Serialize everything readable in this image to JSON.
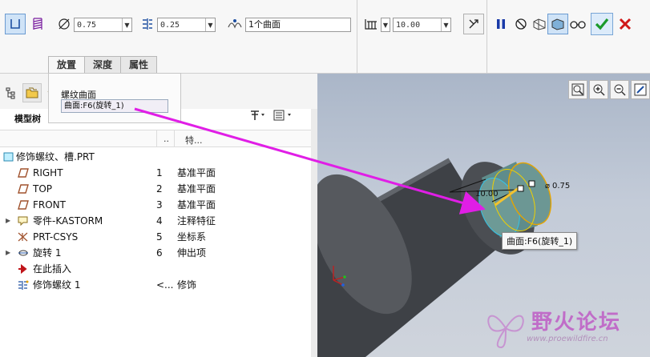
{
  "toolbar": {
    "diameter_value": "0.75",
    "pitch_value": "0.25",
    "surface_ref": "1个曲面",
    "depth_value": "10.00"
  },
  "tabs": [
    {
      "label": "放置"
    },
    {
      "label": "深度"
    },
    {
      "label": "属性"
    }
  ],
  "placement_panel": {
    "label": "螺纹曲面",
    "reference": "曲面:F6(旋转_1)"
  },
  "model_tree": {
    "title": "模型树",
    "col_num": "..",
    "col_type": "特...",
    "rows": [
      {
        "name": "修饰螺纹、槽.PRT",
        "num": "",
        "type": ""
      },
      {
        "name": "RIGHT",
        "num": "1",
        "type": "基准平面"
      },
      {
        "name": "TOP",
        "num": "2",
        "type": "基准平面"
      },
      {
        "name": "FRONT",
        "num": "3",
        "type": "基准平面"
      },
      {
        "name": "零件-KASTORM",
        "num": "4",
        "type": "注释特征"
      },
      {
        "name": "PRT-CSYS",
        "num": "5",
        "type": "坐标系"
      },
      {
        "name": "旋转 1",
        "num": "6",
        "type": "伸出项"
      },
      {
        "name": "在此插入",
        "num": "",
        "type": ""
      },
      {
        "name": "修饰螺纹 1",
        "num": "<...",
        "type": "修饰"
      }
    ]
  },
  "viewport": {
    "tooltip": "曲面:F6(旋转_1)",
    "dim_depth": "10.00",
    "dim_diameter": "0.75"
  },
  "watermark": {
    "text_cn": "野火论坛",
    "text_en": "www.proewildfire.cn"
  },
  "colors": {
    "arrow": "#e01ee6",
    "accept": "#1a9a2a",
    "cancel": "#d01818",
    "pause": "#1a3aa8"
  }
}
